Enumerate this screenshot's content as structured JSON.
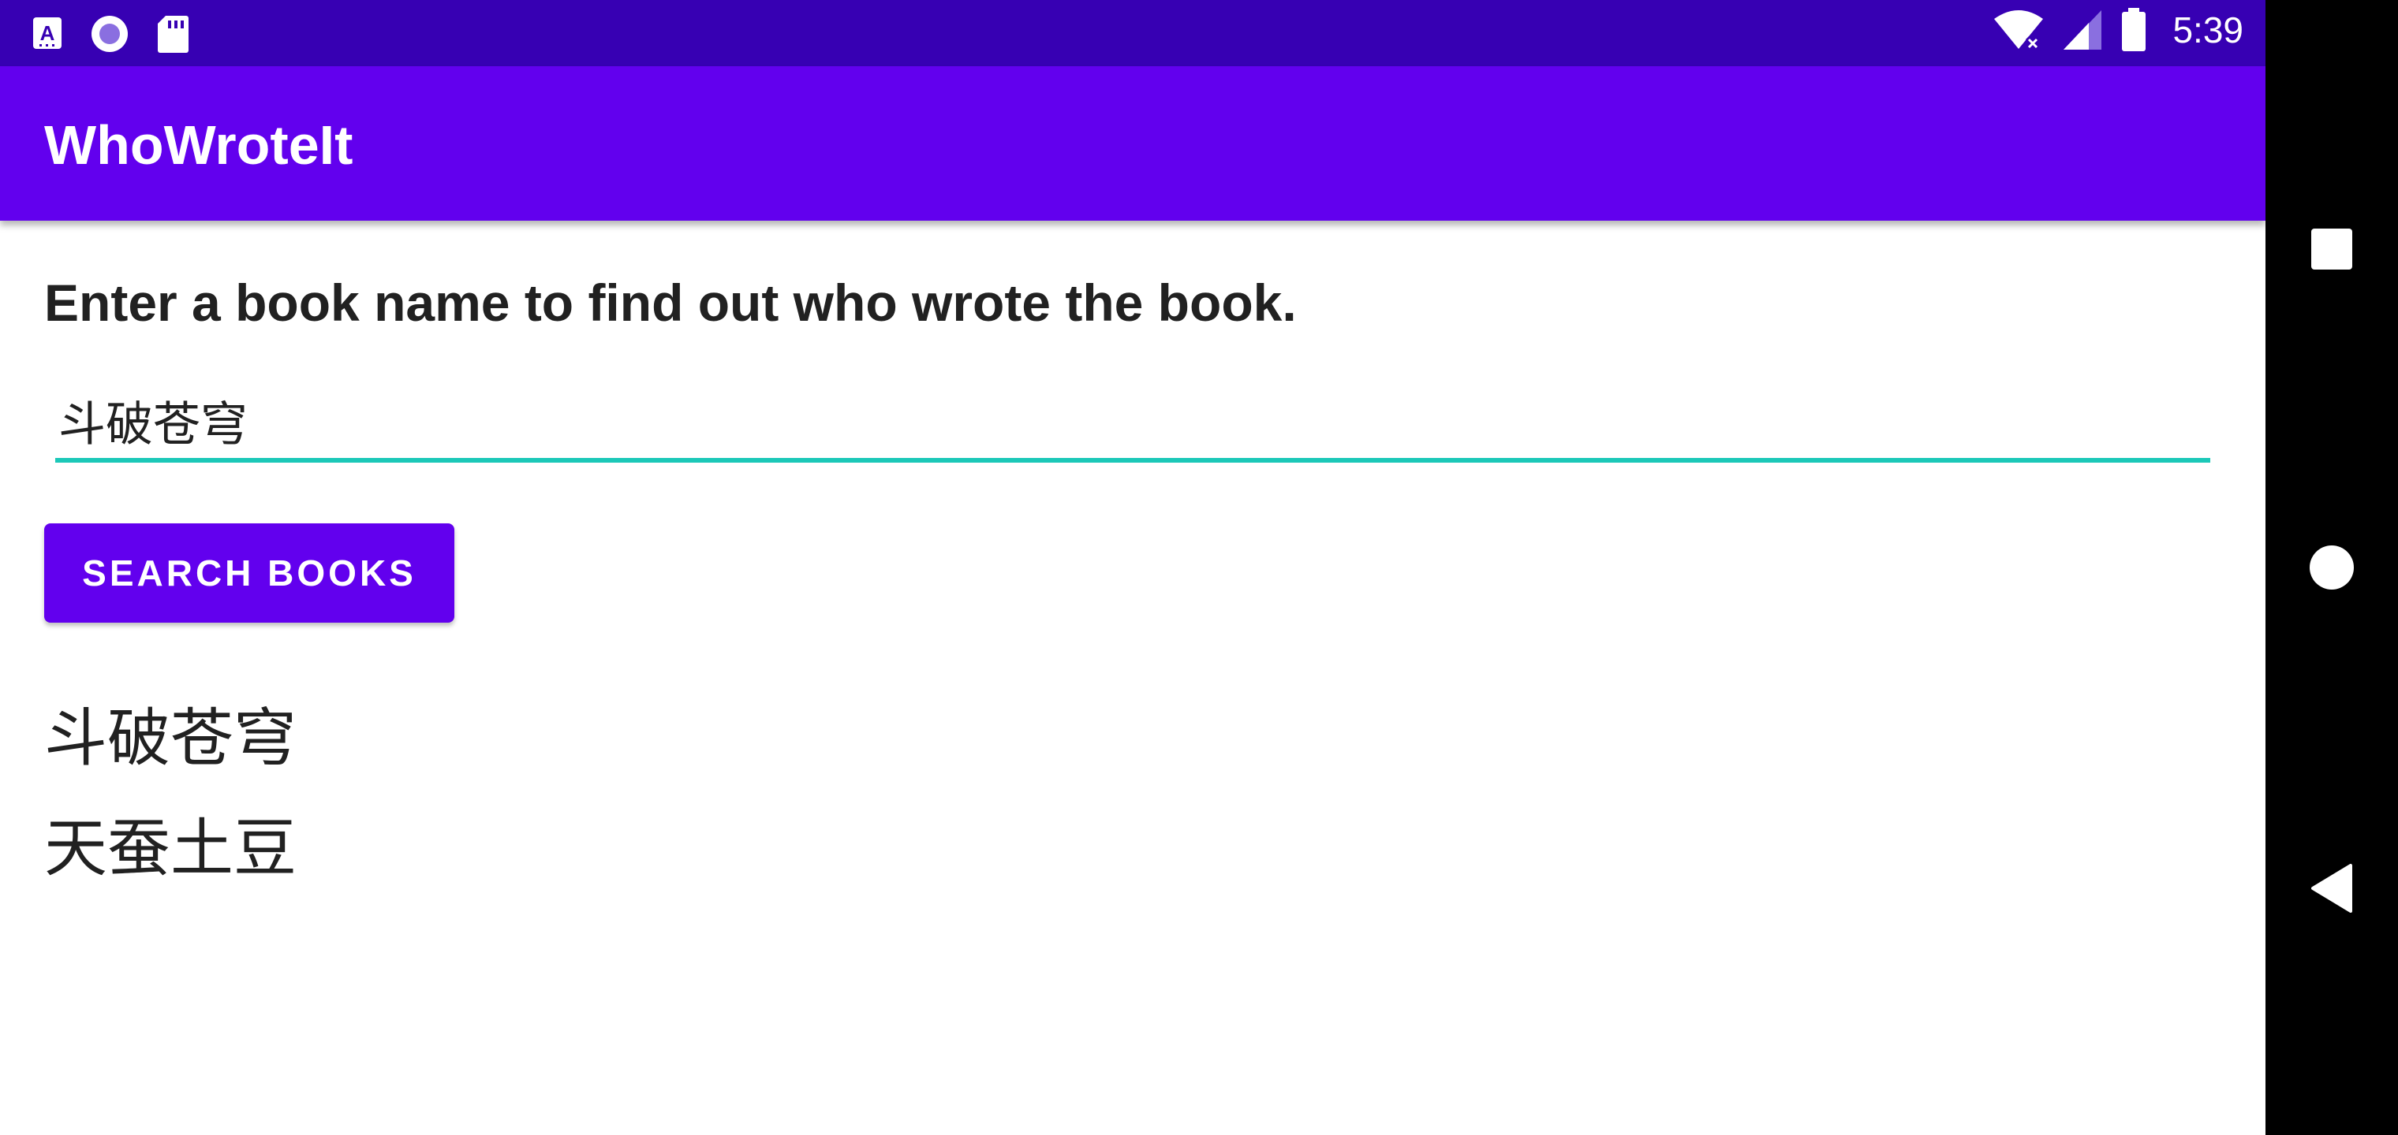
{
  "status_bar": {
    "time": "5:39",
    "left_icons": [
      "font-a-icon",
      "radio-circle-icon",
      "sd-card-icon"
    ],
    "right_icons": [
      "wifi-off-icon",
      "cell-signal-icon",
      "battery-icon"
    ]
  },
  "app_bar": {
    "title": "WhoWroteIt"
  },
  "main": {
    "instruction": "Enter a book name to find out who wrote the book.",
    "book_input_value": "斗破苍穹",
    "search_button_label": "SEARCH BOOKS",
    "result_title": "斗破苍穹",
    "result_author": "天蚕土豆"
  },
  "nav_bar": {
    "buttons": [
      "recents-icon",
      "home-icon",
      "back-icon"
    ]
  },
  "colors": {
    "status_bar": "#3700B3",
    "app_bar": "#6200EE",
    "accent_underline": "#1CC8B8",
    "text": "#212121",
    "nav_bar": "#000000"
  }
}
